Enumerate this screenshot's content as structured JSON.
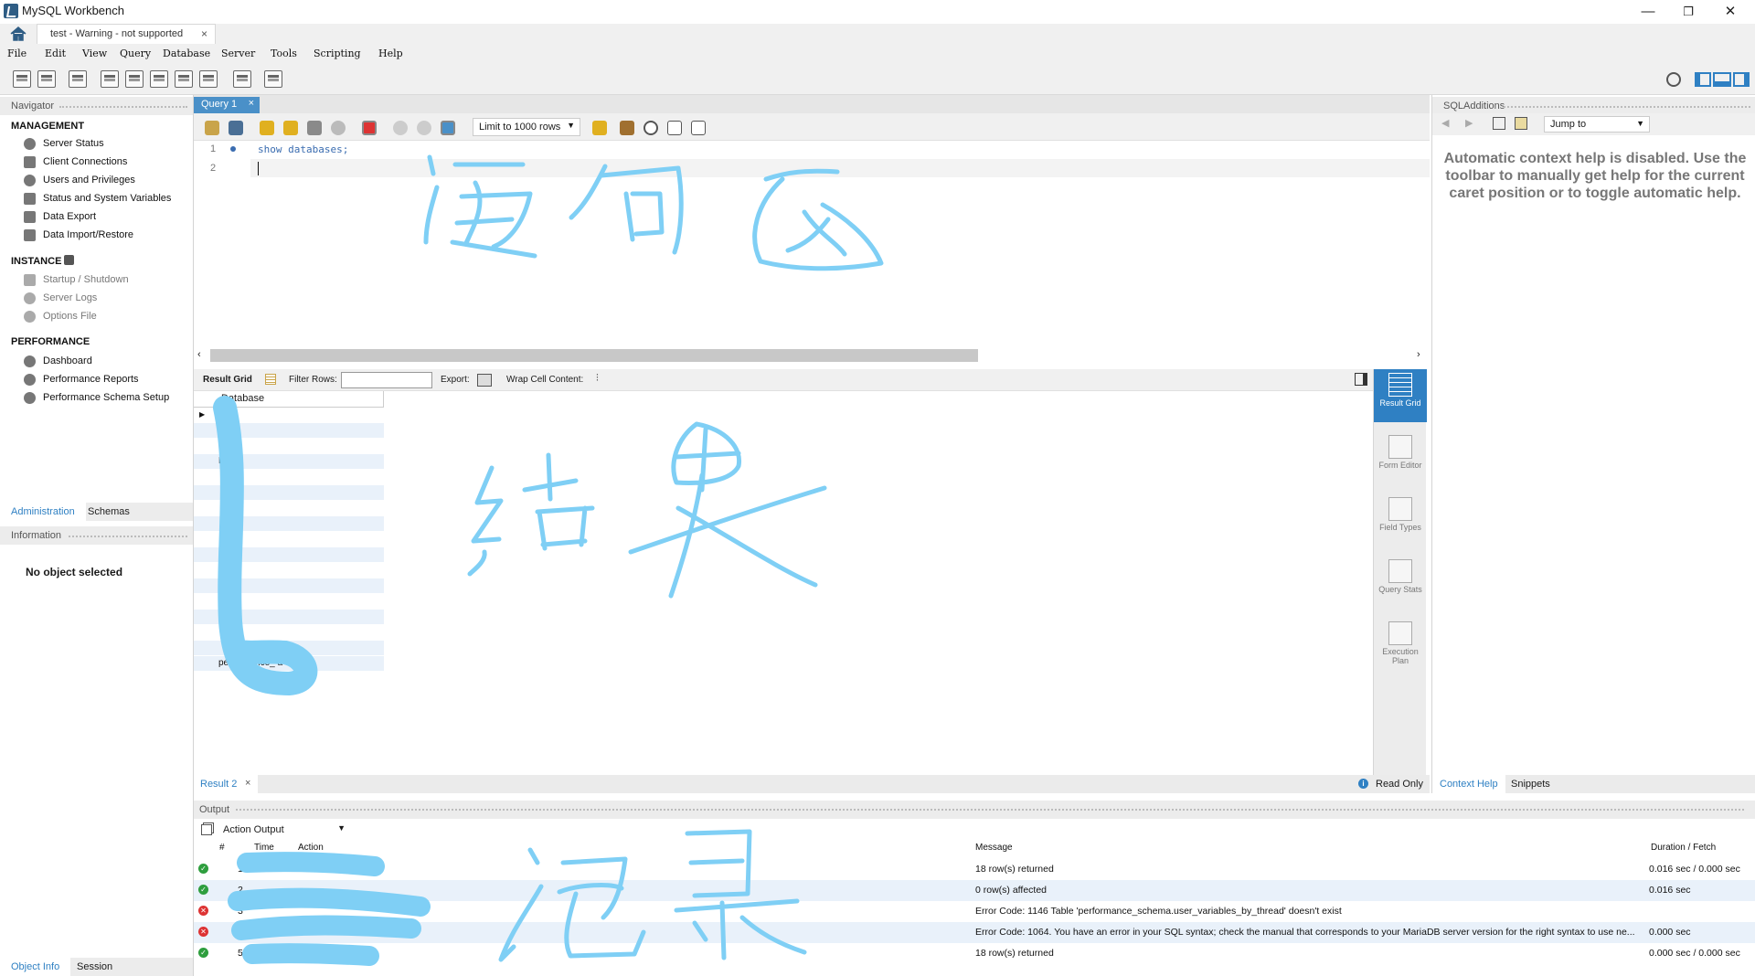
{
  "window": {
    "title": "MySQL Workbench",
    "minimize": "—",
    "restore": "❐",
    "close": "✕"
  },
  "connection_tab": {
    "label": "test - Warning - not supported",
    "close": "×"
  },
  "menu": [
    "File",
    "Edit",
    "View",
    "Query",
    "Database",
    "Server",
    "Tools",
    "Scripting",
    "Help"
  ],
  "navigator": {
    "title": "Navigator",
    "sections": [
      {
        "title": "MANAGEMENT",
        "items": [
          "Server Status",
          "Client Connections",
          "Users and Privileges",
          "Status and System Variables",
          "Data Export",
          "Data Import/Restore"
        ]
      },
      {
        "title": "INSTANCE",
        "items": [
          "Startup / Shutdown",
          "Server Logs",
          "Options File"
        ]
      },
      {
        "title": "PERFORMANCE",
        "items": [
          "Dashboard",
          "Performance Reports",
          "Performance Schema Setup"
        ]
      }
    ],
    "bottom_tabs": [
      "Administration",
      "Schemas"
    ]
  },
  "information": {
    "title": "Information",
    "message": "No object selected",
    "bottom_tabs": [
      "Object Info",
      "Session"
    ]
  },
  "query_tab": {
    "label": "Query 1",
    "close": "×"
  },
  "editor_toolbar": {
    "limit": "Limit to 1000 rows"
  },
  "editor": {
    "lines": [
      {
        "num": "1",
        "text": "show databases;"
      },
      {
        "num": "2",
        "text": ""
      }
    ]
  },
  "result_toolbar": {
    "result_grid": "Result Grid",
    "filter_rows": "Filter Rows:",
    "export": "Export:",
    "wrap": "Wrap Cell Content:"
  },
  "grid": {
    "column": "Database",
    "rows": [
      "w",
      "",
      "",
      "D",
      "",
      "",
      "",
      "",
      "",
      "",
      "",
      "",
      "",
      "",
      "",
      "",
      "performance_   a"
    ]
  },
  "result_side": [
    "Result Grid",
    "Form Editor",
    "Field Types",
    "Query Stats",
    "Execution Plan"
  ],
  "result_tabs": {
    "label": "Result 2",
    "close": "×",
    "read_only": "Read Only"
  },
  "sql_additions": {
    "title": "SQLAdditions",
    "jump_to": "Jump to",
    "help": "Automatic context help is disabled. Use the toolbar to manually get help for the current caret position or to toggle automatic help.",
    "bottom_tabs": [
      "Context Help",
      "Snippets"
    ]
  },
  "output": {
    "title": "Output",
    "mode": "Action Output",
    "columns": {
      "num": "#",
      "time": "Time",
      "action": "Action",
      "message": "Message",
      "duration": "Duration / Fetch"
    },
    "rows": [
      {
        "status": "ok",
        "num": "1",
        "time": "",
        "action": "",
        "message": "18 row(s) returned",
        "duration": "0.016 sec / 0.000 sec"
      },
      {
        "status": "ok",
        "num": "2",
        "time": "",
        "action": "",
        "message": "0 row(s) affected",
        "duration": "0.016 sec"
      },
      {
        "status": "err",
        "num": "3",
        "time": "",
        "action": "",
        "message": "Error Code: 1146 Table 'performance_schema.user_variables_by_thread' doesn't exist",
        "duration": ""
      },
      {
        "status": "err",
        "num": "4",
        "time": "",
        "action": "",
        "message": "Error Code: 1064. You have an error in your SQL syntax; check the manual that corresponds to your MariaDB server version for the right syntax to use ne...",
        "duration": "0.000 sec"
      },
      {
        "status": "ok",
        "num": "5",
        "time": "",
        "action": "",
        "message": "18 row(s) returned",
        "duration": "0.000 sec / 0.000 sec"
      }
    ]
  },
  "colors": {
    "accent": "#2f80c3",
    "ink": "#7fcff5"
  }
}
